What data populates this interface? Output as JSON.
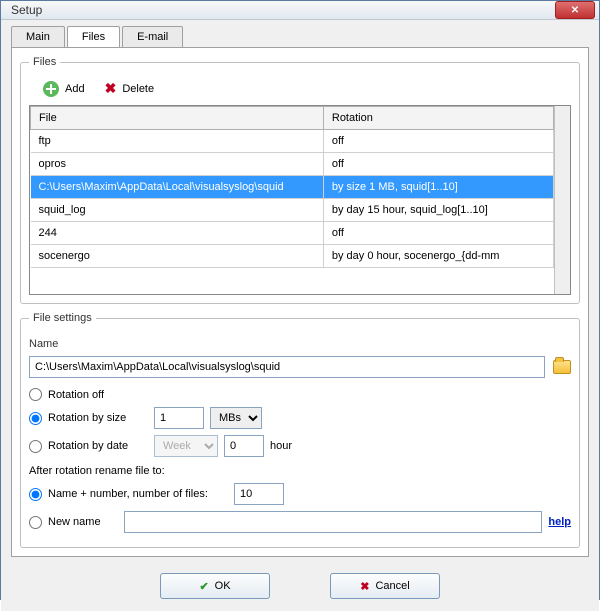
{
  "window": {
    "title": "Setup"
  },
  "tabs": {
    "main": "Main",
    "files": "Files",
    "email": "E-mail",
    "active": "files"
  },
  "filesGroup": {
    "legend": "Files",
    "addLabel": "Add",
    "deleteLabel": "Delete",
    "columns": {
      "file": "File",
      "rotation": "Rotation"
    },
    "rows": [
      {
        "file": "ftp",
        "rotation": "off",
        "selected": false
      },
      {
        "file": "opros",
        "rotation": "off",
        "selected": false
      },
      {
        "file": "C:\\Users\\Maxim\\AppData\\Local\\visualsyslog\\squid",
        "rotation": "by size 1 MB, squid[1..10]",
        "selected": true
      },
      {
        "file": "squid_log",
        "rotation": "by day 15 hour, squid_log[1..10]",
        "selected": false
      },
      {
        "file": "244",
        "rotation": "off",
        "selected": false
      },
      {
        "file": "socenergo",
        "rotation": "by day 0 hour, socenergo_{dd-mm",
        "selected": false
      }
    ]
  },
  "fileSettings": {
    "legend": "File settings",
    "nameLabel": "Name",
    "nameValue": "C:\\Users\\Maxim\\AppData\\Local\\visualsyslog\\squid",
    "rotationOff": "Rotation off",
    "rotationBySize": "Rotation by size",
    "sizeValue": "1",
    "sizeUnit": "MBs",
    "rotationByDate": "Rotation by date",
    "dateUnit": "Week",
    "dateHourValue": "0",
    "hourLabel": "hour",
    "afterLabel": "After rotation rename file to:",
    "nameNumber": "Name + number, number of files:",
    "numberValue": "10",
    "newName": "New name",
    "newNameValue": "",
    "helpLabel": "help"
  },
  "buttons": {
    "ok": "OK",
    "cancel": "Cancel"
  }
}
